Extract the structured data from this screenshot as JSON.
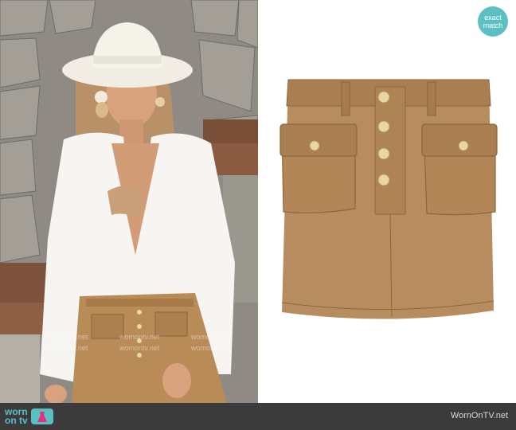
{
  "badge": {
    "line1": "exact",
    "line2": "match"
  },
  "footer": {
    "logo_line1": "worn",
    "logo_line2": "on tv",
    "site": "WornOnTV.net"
  },
  "watermark": "womontv.net",
  "colors": {
    "accent": "#5bc0c4",
    "footer_bg": "#3b3b3b",
    "skirt": "#b78c5e"
  },
  "icons": [
    "tv-dress-icon"
  ]
}
